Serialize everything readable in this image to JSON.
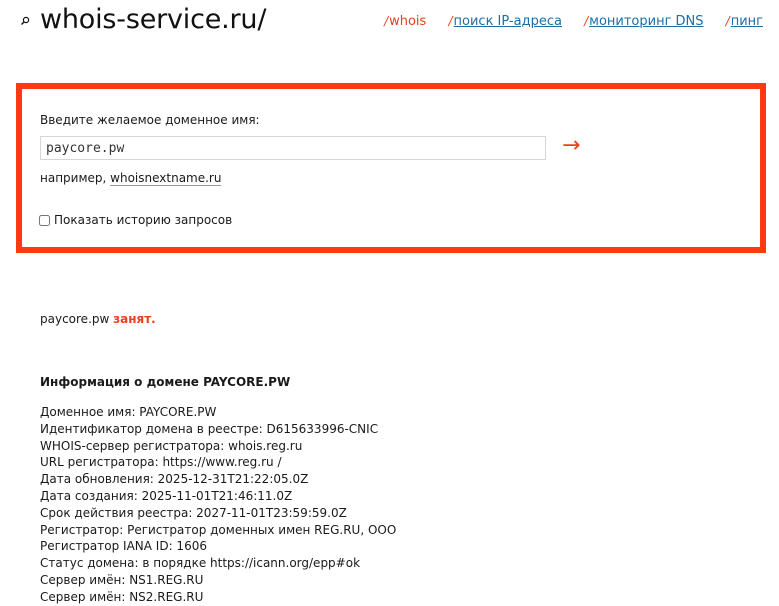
{
  "header": {
    "logo_text": "whois-service.ru/",
    "nav": [
      {
        "label": "whois",
        "active": true
      },
      {
        "label": "поиск IP-адреса",
        "active": false
      },
      {
        "label": "мониторинг DNS",
        "active": false
      },
      {
        "label": "пинг",
        "active": false
      }
    ],
    "nav_separator": "/"
  },
  "search": {
    "label": "Введите желаемое доменное имя:",
    "value": "paycore.pw",
    "submit_glyph": "→",
    "example_prefix": "например,",
    "example_link": "whoisnextname.ru",
    "history_label": "Показать историю запросов",
    "history_checked": false
  },
  "result": {
    "domain": "paycore.pw",
    "status_word": "занят."
  },
  "info": {
    "title": "Информация о домене PAYCORE.PW",
    "lines": [
      "Доменное имя: PAYCORE.PW",
      "Идентификатор домена в реестре: D615633996-CNIC",
      "WHOIS-сервер регистратора: whois.reg.ru",
      "URL регистратора: https://www.reg.ru /",
      "Дата обновления: 2025-12-31T21:22:05.0Z",
      "Дата создания: 2025-11-01T21:46:11.0Z",
      "Срок действия реестра: 2027-11-01T23:59:59.0Z",
      "Регистратор: Регистратор доменных имен REG.RU, OOO",
      "Регистратор IANA ID: 1606",
      "Статус домена: в порядке https://icann.org/epp#ok",
      "Сервер имён: NS1.REG.RU",
      "Сервер имён: NS2.REG.RU"
    ]
  },
  "colors": {
    "accent": "#e8401c",
    "border": "#ff3a0e",
    "link": "#1a6fa8"
  },
  "icons": {
    "logo": "search-icon"
  }
}
